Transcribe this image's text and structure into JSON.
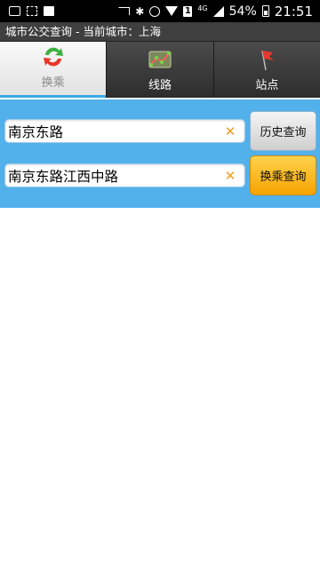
{
  "status_bar": {
    "battery": "54%",
    "time": "21:51",
    "network": "4G",
    "sim": "1"
  },
  "title_bar": {
    "title": "城市公交查询 - 当前城市：上海"
  },
  "tabs": [
    {
      "label": "换乘",
      "active": true,
      "icon": "transfer-arrows-icon"
    },
    {
      "label": "线路",
      "active": false,
      "icon": "route-map-icon"
    },
    {
      "label": "站点",
      "active": false,
      "icon": "station-flag-icon"
    }
  ],
  "search": {
    "origin_value": "南京东路",
    "destination_value": "南京东路江西中路",
    "history_button": "历史查询",
    "transfer_button": "换乘查询"
  },
  "colors": {
    "panel_bg": "#52b0ea",
    "active_tab_underline": "#3aa9e7",
    "clear_icon": "#f39c1b",
    "transfer_button": "#f5a300"
  }
}
